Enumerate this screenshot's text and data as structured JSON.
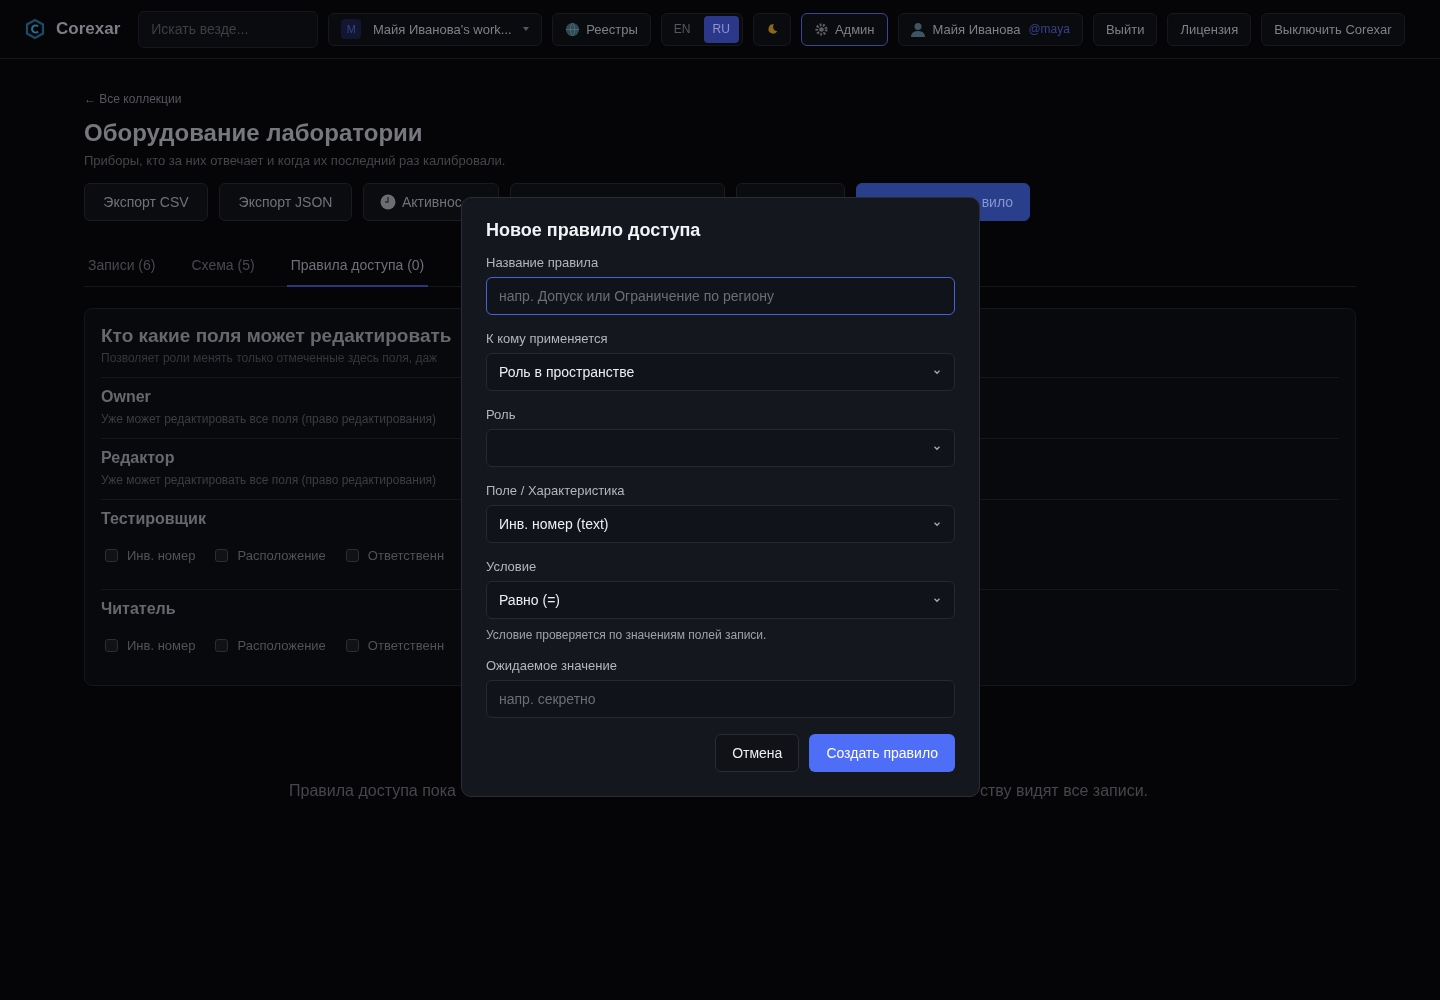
{
  "topbar": {
    "logo": "Corexar",
    "search": {
      "placeholder": "Искать везде..."
    },
    "workspace": {
      "badge": "M",
      "label": "Майя Иванова's work..."
    },
    "registries": "Реестры",
    "languages": [
      {
        "label": "EN",
        "selected": false
      },
      {
        "label": "RU",
        "selected": true
      }
    ],
    "admin": {
      "label": "Админ",
      "selected": true
    },
    "user": {
      "name": "Майя Иванова",
      "handle": "@maya"
    },
    "actions": [
      "Выйти",
      "Лицензия",
      "Выключить Corexar"
    ]
  },
  "page": {
    "back_link": "← Все коллекции",
    "title": "Оборудование лаборатории",
    "subtitle": "Приборы, кто за них отвечает и когда их последний раз калибровали.",
    "toolbar": [
      {
        "kind": "plain",
        "label": "Экспорт CSV"
      },
      {
        "kind": "plain",
        "label": "Экспорт JSON"
      },
      {
        "kind": "clock",
        "label": "Активнос"
      },
      {
        "kind": "blank"
      },
      {
        "kind": "blank"
      },
      {
        "kind": "primary",
        "label": "вило"
      }
    ],
    "tabs": [
      {
        "label": "Записи (6)",
        "selected": false
      },
      {
        "label": "Схема (5)",
        "selected": false
      },
      {
        "label": "Правила доступа (0)",
        "selected": true
      }
    ],
    "access_card": {
      "title": "Кто какие поля может редактировать",
      "subtitle": "Позволяет роли менять только отмеченные здесь поля, даж",
      "roles": [
        {
          "kind": "note",
          "name": "Owner",
          "note": "Уже может редактировать все поля (право редактирования)"
        },
        {
          "kind": "note",
          "name": "Редактор",
          "note": "Уже может редактировать все поля (право редактирования)"
        },
        {
          "kind": "fields",
          "name": "Тестировщик",
          "fields": [
            {
              "label": "Инв. номер",
              "checked": false
            },
            {
              "label": "Расположение",
              "checked": false
            },
            {
              "label": "Ответственн",
              "checked": false
            }
          ]
        },
        {
          "kind": "fields",
          "name": "Читатель",
          "fields": [
            {
              "label": "Инв. номер",
              "checked": false
            },
            {
              "label": "Расположение",
              "checked": false
            },
            {
              "label": "Ответственн",
              "checked": false
            }
          ]
        }
      ]
    },
    "empty_text": {
      "left": "Правила доступа пока",
      "right": "ству видят все записи."
    }
  },
  "modal": {
    "title": "Новое правило доступа",
    "fields": [
      {
        "kind": "input",
        "label": "Название правила",
        "placeholder": "напр. Допуск или Ограничение по региону",
        "focused": true
      },
      {
        "kind": "select",
        "label": "К кому применяется",
        "value": "Роль в пространстве"
      },
      {
        "kind": "select",
        "label": "Роль"
      },
      {
        "kind": "select",
        "label": "Поле / Характеристика",
        "value": "Инв. номер (text)"
      },
      {
        "kind": "select",
        "label": "Условие",
        "value": "Равно (=)",
        "hint": "Условие проверяется по значениям полей записи."
      },
      {
        "kind": "input",
        "label": "Ожидаемое значение",
        "placeholder": "напр. секретно",
        "focused": false
      }
    ],
    "cancel": "Отмена",
    "submit": "Создать правило"
  }
}
